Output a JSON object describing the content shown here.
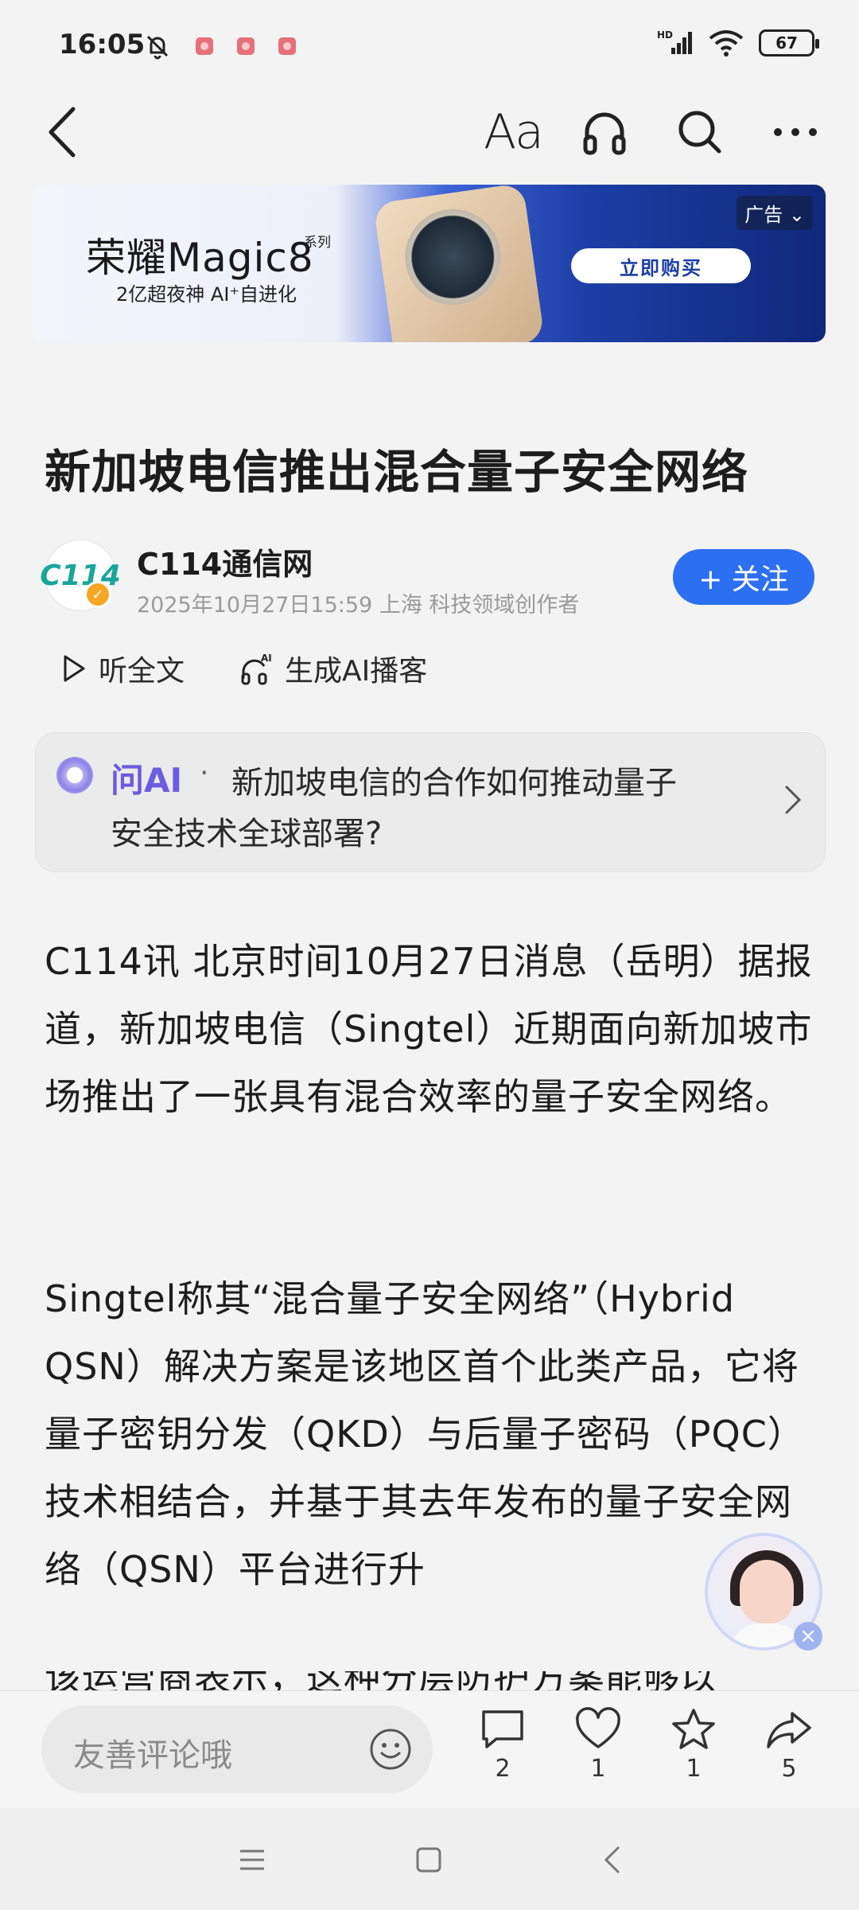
{
  "status_bar": {
    "time": "16:05",
    "battery": "67",
    "network": "HD"
  },
  "toolbar": {
    "font_label": "Aa"
  },
  "ad": {
    "title": "荣耀Magic8",
    "series": "系列",
    "subtitle": "2亿超夜神 AI⁺自进化",
    "cta": "立即购买",
    "tag": "广告"
  },
  "article": {
    "title": "新加坡电信推出混合量子安全网络",
    "author": "C114通信网",
    "meta": "2025年10月27日15:59 上海 科技领域创作者",
    "follow_label": "+ 关注",
    "listen_label": "听全文",
    "podcast_label": "生成AI播客",
    "paragraphs": [
      "C114讯 北京时间10月27日消息（岳明）据报道，新加坡电信（Singtel）近期面向新加坡市场推出了一张具有混合效率的量子安全网络。",
      "Singtel称其“混合量子安全网络”（Hybrid QSN）解决方案是该地区首个此类产品，它将量子密钥分发（QKD）与后量子密码（PQC）技术相结合，并基于其去年发布的量子安全网络（QSN）平台进行升"
    ],
    "cut_line": "该运营商表示，这种分层防护方案能够以"
  },
  "ask_ai": {
    "label": "问AI",
    "separator": "·",
    "question_line1": "新加坡电信的合作如何推动量子",
    "question_line2": "安全技术全球部署?"
  },
  "bottom_bar": {
    "comment_placeholder": "友善评论哦",
    "comments": "2",
    "likes": "1",
    "favorites": "1",
    "shares": "5"
  },
  "colors": {
    "accent": "#2c6ff0",
    "ai_purple": "#6b5ce0",
    "background": "#f3f3f3"
  }
}
